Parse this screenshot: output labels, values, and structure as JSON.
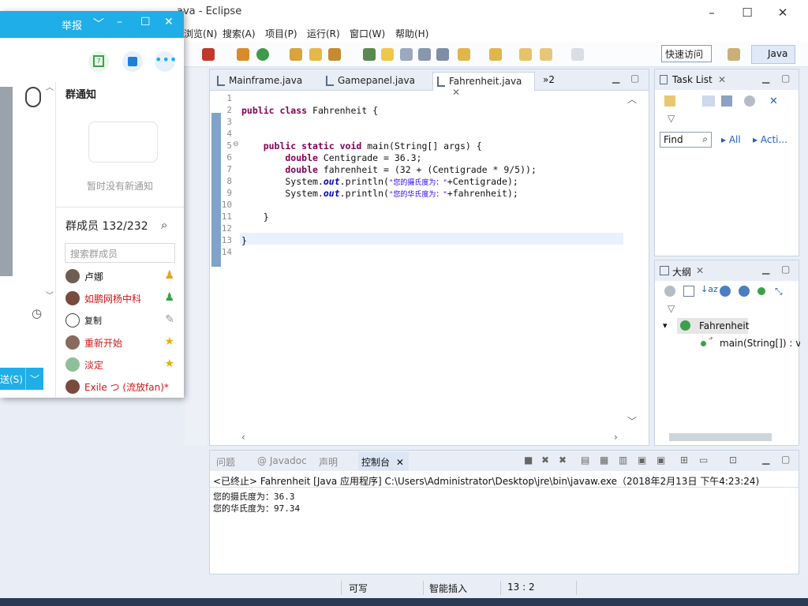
{
  "window": {
    "title": "ava - Eclipse"
  },
  "menu": [
    "浏览(N)",
    "搜索(A)",
    "项目(P)",
    "运行(R)",
    "窗口(W)",
    "帮助(H)"
  ],
  "toolbar": {
    "quick_access": "快速访问",
    "perspective": "Java"
  },
  "editor": {
    "tabs": [
      {
        "label": "Mainframe.java"
      },
      {
        "label": "Gamepanel.java"
      },
      {
        "label": "Fahrenheit.java",
        "active": true
      }
    ],
    "overflow_label": "»2",
    "line_numbers": [
      "1",
      "2",
      "3",
      "4",
      "5",
      "6",
      "7",
      "8",
      "9",
      "10",
      "11",
      "12",
      "13",
      "14"
    ],
    "code": {
      "l2_kw": "public class",
      "l2_rest": " Fahrenheit {",
      "l5_kw": "    public static void",
      "l5_rest": " main(String[] args) {",
      "l6_kw": "        double",
      "l6_rest": " Centigrade = 36.3;",
      "l7_kw": "        double",
      "l7_rest": " fahrenheit = (32 + (Centigrade * 9/5));",
      "l8_a": "        System.",
      "l8_out": "out",
      "l8_b": ".println(",
      "l8_str": "\"您的摄氏度为：\"",
      "l8_c": "+Centigrade);",
      "l9_a": "        System.",
      "l9_out": "out",
      "l9_b": ".println(",
      "l9_str": "\"您的华氏度为：\"",
      "l9_c": "+fahrenheit);",
      "l11": "    }",
      "l13": "}"
    }
  },
  "tasklist": {
    "title": "Task List",
    "find_placeholder": "Find",
    "all": "All",
    "acti": "Acti..."
  },
  "outline": {
    "title": "大纲",
    "class_name": "Fahrenheit",
    "method": "main(String[]) : vc"
  },
  "console": {
    "tabs": [
      "问题",
      "@ Javadoc",
      "声明",
      "控制台"
    ],
    "header": "<已终止> Fahrenheit [Java 应用程序] C:\\Users\\Administrator\\Desktop\\jre\\bin\\javaw.exe（2018年2月13日 下午4:23:24)",
    "lines": [
      "您的摄氏度为：36.3",
      "您的华氏度为：97.34"
    ]
  },
  "status": {
    "writable": "可写",
    "insert_mode": "智能插入",
    "position": "13 : 2"
  },
  "qq": {
    "report": "举报",
    "notice_title": "群通知",
    "notice_empty": "暂时没有新通知",
    "members_label": "群成员 132/232",
    "search_placeholder": "搜索群成员",
    "members": [
      {
        "name": "卢娜",
        "color": "#222222"
      },
      {
        "name": "如鹏网杨中科",
        "color": "#d01818"
      },
      {
        "name": "复制",
        "color": "#222222"
      },
      {
        "name": "重新开始",
        "color": "#d01818"
      },
      {
        "name": "淡定",
        "color": "#d01818"
      },
      {
        "name": "Exile つ (流放fan)*",
        "color": "#d01818"
      }
    ],
    "send_label": "送(S)"
  }
}
